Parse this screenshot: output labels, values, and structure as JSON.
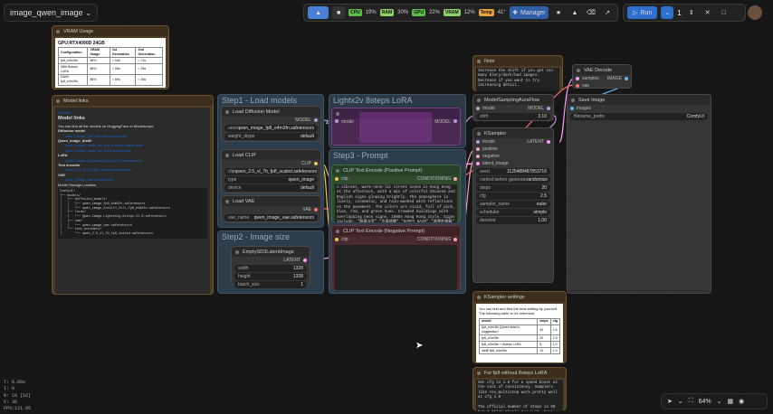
{
  "workflow": {
    "title": "image_qwen_image"
  },
  "toolbar": {
    "stats": [
      {
        "badge": "CPU",
        "value": "19%",
        "color": "#5dbb4a"
      },
      {
        "badge": "RAM",
        "value": "30%",
        "color": "#8fd16a"
      },
      {
        "badge": "GPU",
        "value": "22%",
        "color": "#5dbb4a"
      },
      {
        "badge": "VRAM",
        "value": "12%",
        "color": "#8fd16a"
      },
      {
        "badge": "Temp",
        "value": "41°",
        "color": "#e6a23c"
      }
    ],
    "manager_label": "Manager",
    "run_label": "Run",
    "queue_count": "1"
  },
  "groups": [
    {
      "title": "Step1 - Load models"
    },
    {
      "title": "Lightx2v 8steps LoRA"
    },
    {
      "title": "Step3 - Prompt"
    },
    {
      "title": "Step2 - Image size"
    }
  ],
  "vram_node": {
    "title": "VRAM Usage",
    "heading": "GPU:RTX4090D 24GB",
    "headers": [
      "Configuration",
      "VRAM Usage",
      "1st Generation",
      "2nd Generation"
    ],
    "rows": [
      [
        "fp8_e4m3fn",
        "86%",
        "≈ 94s",
        "≈ 71s"
      ],
      [
        "With 8steps LoRA",
        "86%",
        "≈ 55s",
        "≈ 34s"
      ],
      [
        "Distill fp8_e4m3fn",
        "86%",
        "≈ 69s",
        "≈ 36s"
      ]
    ]
  },
  "model_links": {
    "title": "Model links",
    "tutorial": "Tutorial",
    "heading": "Model links",
    "intro": "You can find all the models on HuggingFace or Modelscope",
    "sections": [
      {
        "label": "Diffusion model",
        "links": [
          "qwen_image_fp8_e4m3fn.safetensors"
        ]
      },
      {
        "label": "Qwen_image_distill",
        "links": [
          "qwen_image_distill_full_fp8_e4m3fn.safetensors",
          "qwen_image_distill_full_bf16.safetensors"
        ]
      },
      {
        "label": "LoRA",
        "links": [
          "Qwen-Image-Lightning-8steps-V1.0.safetensors"
        ]
      },
      {
        "label": "Text encoder",
        "links": [
          "qwen_2.5_vl_7b_fp8_scaled.safetensors"
        ]
      },
      {
        "label": "VAE",
        "links": [
          "qwen_image_vae.safetensors"
        ]
      }
    ],
    "storage_label": "Model Storage Location",
    "tree": "ComfyUI/\n├── models/\n│   ├── diffusion_models/\n│   │   ├── qwen_image_fp8_e4m3fn.safetensors\n│   │   └── qwen_image_distill_full_fp8_e4m3fn.safetensors\n│   ├── loras/\n│   │   └── Qwen-Image-Lightning-8steps-V1.0.safetensors\n│   ├── vae/\n│   │   └── qwen_image_vae.safetensors\n│   └── text_encoders/\n│       └── qwen_2.5_vl_7b_fp8_scaled.safetensors"
  },
  "load_diffusion": {
    "title": "Load Diffusion Model",
    "unet_label": "unet",
    "unet_value": "qwen_image_fp8_e4m3fn.safetensors",
    "dtype_label": "weight_dtype",
    "dtype_value": "default",
    "out": "MODEL"
  },
  "load_clip": {
    "title": "Load CLIP",
    "clip_label": "clip",
    "clip_value": "qwen_2.5_vl_7b_fp8_scaled.safetensors",
    "type_label": "type",
    "type_value": "qwen_image",
    "device_label": "device",
    "device_value": "default",
    "out": "CLIP"
  },
  "load_vae": {
    "title": "Load VAE",
    "vae_label": "vae_name",
    "vae_value": "qwen_image_vae.safetensors",
    "out": "VAE"
  },
  "empty_latent": {
    "title": "EmptySD3LatentImage",
    "out": "LATENT",
    "width_label": "width",
    "width_value": "1328",
    "height_label": "height",
    "height_value": "1328",
    "batch_label": "batch_size",
    "batch_value": "1"
  },
  "lora_node": {
    "title": "LoraLoaderModelOnly",
    "in": "model",
    "out": "MODEL",
    "w1": "Qwen-Image-Lightning-8steps-V1.0",
    "w2": "strength_model 1.00"
  },
  "pos_prompt": {
    "title": "CLIP Text Encode (Positive Prompt)",
    "in": "clip",
    "out": "CONDITIONING",
    "text": "A vibrant, warm neon-lit street scene in Hong Kong at the afternoon, with a mix of colorful Chinese and English signs glowing brightly. The atmosphere is lively, cinematic, and rain-washed with reflections on the pavement. The colors are vivid, full of pink, blue, red, and green hues. Crowded buildings with overlapping neon signs. 1980s Hong Kong style. Signs include:\n\"龍鳳冰室\" \"金華燒臘\" \"HAPPY HAIR\" \"鴻運茶餐廳\" \"EASY BAR\" \"永發魚蛋粉\" \"添記粥麵\" \"SUNSHINE MOTEL\" \"美都餐室\" \"富記糖水\" \"太平館\" \"雅芳髮型屋\" \"STAR KTV\" \"銀河娛樂城\" \"百樂門舞廳\"..."
  },
  "neg_prompt": {
    "title": "CLIP Text Encode (Negative Prompt)",
    "in": "clip",
    "out": "CONDITIONING"
  },
  "note_node": {
    "title": "Note",
    "text": "Increase the shift if you get too many blury/dark/bad images. Decrease if you want to try increasing detail."
  },
  "model_sampling": {
    "title": "ModelSamplingAuraFlow",
    "in": "model",
    "out": "MODEL",
    "shift_label": "shift",
    "shift_value": "3.10"
  },
  "ksampler": {
    "title": "KSampler",
    "inputs": [
      "model",
      "positive",
      "negative",
      "latent_image"
    ],
    "out": "LATENT",
    "widgets": [
      {
        "label": "seed",
        "value": "1125488487853716"
      },
      {
        "label": "control before generate",
        "value": "randomize"
      },
      {
        "label": "steps",
        "value": "20"
      },
      {
        "label": "cfg",
        "value": "2.5"
      },
      {
        "label": "sampler_name",
        "value": "euler"
      },
      {
        "label": "scheduler",
        "value": "simple"
      },
      {
        "label": "denoise",
        "value": "1.00"
      }
    ]
  },
  "vae_decode": {
    "title": "VAE Decode",
    "inputs": [
      "samples",
      "vae"
    ],
    "out": "IMAGE"
  },
  "save_image": {
    "title": "Save Image",
    "in": "images",
    "prefix_label": "filename_prefix",
    "prefix_value": "ComfyUI"
  },
  "ksampler_settings": {
    "title": "KSampler settings",
    "intro": "You can test and find the best setting by yourself. The following table is for reference.",
    "headers": [
      "model",
      "steps",
      "cfg"
    ],
    "rows": [
      [
        "fp8_e4m3fn (Qwen team's suggestion)",
        "40",
        "2.5"
      ],
      [
        "fp8_e4m3fn",
        "20",
        "2.5"
      ],
      [
        "fp8_e4m3fn + 8steps LoRA",
        "8",
        "1.0"
      ],
      [
        "distill fp8_e4m3fn",
        "10",
        "1.0"
      ]
    ]
  },
  "fp8_note": {
    "title": "For fp8 without 8steps LoRA",
    "text": "Set cfg to 1.0 for a speed boost at the cost of consistency. Samplers like res_multistep work pretty well at cfg 1.0\n\nThe official number of steps is 50 but I think that's too much. Even just 10 steps seems to work."
  },
  "stats_overlay": {
    "lines": [
      "T: 0.00s",
      "I: 0",
      "N: 16 [16]",
      "V: 36",
      "FPS:121.95"
    ]
  },
  "bottom": {
    "zoom": "64%"
  }
}
